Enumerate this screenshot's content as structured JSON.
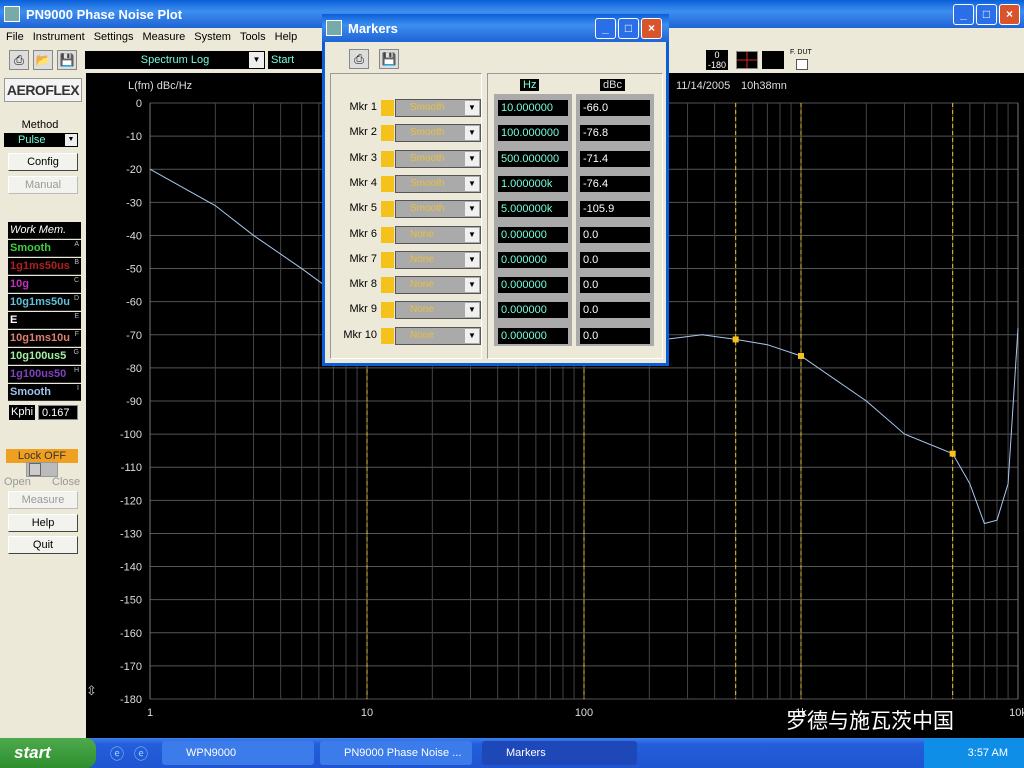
{
  "window": {
    "title": "PN9000 Phase Noise Plot",
    "controls": [
      "_",
      "□",
      "×"
    ]
  },
  "menu": [
    "File",
    "Instrument",
    "Settings",
    "Measure",
    "System",
    "Tools",
    "Help"
  ],
  "toolbar": {
    "mode": "Spectrum Log",
    "start_label": "Start",
    "range_top": "0",
    "range_bottom": "-180",
    "fdut_label": "F. DUT"
  },
  "sidebar": {
    "logo": "AEROFLEX",
    "method_label": "Method",
    "method_value": "Pulse",
    "config": "Config",
    "manual": "Manual",
    "work_mem_title": "Work Mem.",
    "work_mem": [
      {
        "label": "Smooth",
        "tag": "A",
        "color": "#3fcf3f"
      },
      {
        "label": "1g1ms50us",
        "tag": "B",
        "color": "#b02020"
      },
      {
        "label": "10g",
        "tag": "C",
        "color": "#c030c0"
      },
      {
        "label": "10g1ms50u",
        "tag": "D",
        "color": "#60c0d8"
      },
      {
        "label": "E",
        "tag": "E",
        "color": "#ffffff"
      },
      {
        "label": "10g1ms10u",
        "tag": "F",
        "color": "#e08070"
      },
      {
        "label": "10g100us5",
        "tag": "G",
        "color": "#a0f0a0"
      },
      {
        "label": "1g100us50",
        "tag": "H",
        "color": "#8040c0"
      },
      {
        "label": "Smooth",
        "tag": "I",
        "color": "#a0c0f0"
      }
    ],
    "kphi_label": "Kphi",
    "kphi_value": "0.167",
    "lock": "Lock OFF",
    "open": "Open",
    "close": "Close",
    "measure": "Measure",
    "help": "Help",
    "quit": "Quit"
  },
  "plot": {
    "date": "11/14/2005",
    "time": "10h38mn"
  },
  "chart_data": {
    "type": "line",
    "ylabel": "L(fm) dBc/Hz",
    "xscale": "log",
    "xlim": [
      1,
      10000
    ],
    "ylim": [
      -180,
      0
    ],
    "yticks": [
      0,
      -10,
      -20,
      -30,
      -40,
      -50,
      -60,
      -70,
      -80,
      -90,
      -100,
      -110,
      -120,
      -130,
      -140,
      -150,
      -160,
      -170,
      -180
    ],
    "xticks": [
      {
        "v": 1,
        "label": "1"
      },
      {
        "v": 10,
        "label": "10"
      },
      {
        "v": 100,
        "label": "100"
      },
      {
        "v": 1000,
        "label": "1k"
      },
      {
        "v": 10000,
        "label": "10k"
      }
    ],
    "grid": true,
    "trace_color": "#a8c8f0",
    "marker_color": "#f5c21b",
    "x": [
      1,
      2,
      3,
      5,
      7,
      10,
      30,
      100,
      200,
      350,
      500,
      700,
      1000,
      2000,
      3000,
      5000,
      6000,
      7000,
      8000,
      9000,
      10000
    ],
    "y": [
      -20,
      -31,
      -40,
      -50,
      -57,
      -66,
      -75,
      -76.8,
      -72,
      -70,
      -71.4,
      -73,
      -76.4,
      -90,
      -100,
      -105.9,
      -115,
      -127,
      -126,
      -115,
      -68
    ]
  },
  "markers_dialog": {
    "title": "Markers",
    "hz_header": "Hz",
    "dbc_header": "dBc",
    "rows": [
      {
        "name": "Mkr 1",
        "trace": "Smooth",
        "hz": "10.000000",
        "dbc": "-66.0"
      },
      {
        "name": "Mkr 2",
        "trace": "Smooth",
        "hz": "100.000000",
        "dbc": "-76.8"
      },
      {
        "name": "Mkr 3",
        "trace": "Smooth",
        "hz": "500.000000",
        "dbc": "-71.4"
      },
      {
        "name": "Mkr 4",
        "trace": "Smooth",
        "hz": "1.000000k",
        "dbc": "-76.4"
      },
      {
        "name": "Mkr 5",
        "trace": "Smooth",
        "hz": "5.000000k",
        "dbc": "-105.9"
      },
      {
        "name": "Mkr 6",
        "trace": "None",
        "hz": "0.000000",
        "dbc": "0.0"
      },
      {
        "name": "Mkr 7",
        "trace": "None",
        "hz": "0.000000",
        "dbc": "0.0"
      },
      {
        "name": "Mkr 8",
        "trace": "None",
        "hz": "0.000000",
        "dbc": "0.0"
      },
      {
        "name": "Mkr 9",
        "trace": "None",
        "hz": "0.000000",
        "dbc": "0.0"
      },
      {
        "name": "Mkr 10",
        "trace": "None",
        "hz": "0.000000",
        "dbc": "0.0"
      }
    ]
  },
  "watermark": "罗德与施瓦茨中国",
  "taskbar": {
    "start": "start",
    "tasks": [
      "WPN9000",
      "PN9000 Phase Noise ...",
      "Markers"
    ],
    "clock": "3:57 AM"
  }
}
